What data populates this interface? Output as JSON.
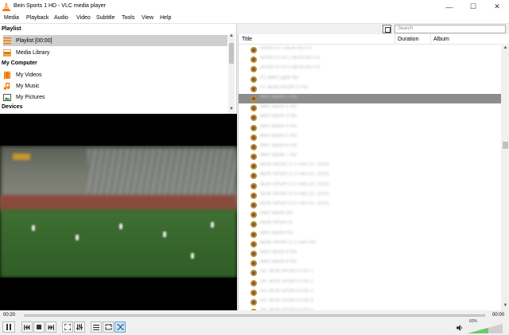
{
  "window": {
    "title": "Bein Sports 1 HD - VLC media player",
    "min_glyph": "—",
    "max_glyph": "☐",
    "close_glyph": "✕"
  },
  "menu": [
    "Media",
    "Playback",
    "Audio",
    "Video",
    "Subtitle",
    "Tools",
    "View",
    "Help"
  ],
  "sidebar": {
    "playlist_header": "Playlist",
    "playlist_item": "Playlist [00:00]",
    "media_library": "Media Library",
    "mycomputer_header": "My Computer",
    "my_videos": "My Videos",
    "my_music": "My Music",
    "my_pictures": "My Pictures",
    "devices_header": "Devices"
  },
  "search": {
    "placeholder": "Search"
  },
  "playlist": {
    "columns": {
      "title": "Title",
      "duration": "Duration",
      "album": "Album"
    },
    "current_index": 5,
    "rows": [
      "SPORTS 1 BEIN HD FR",
      "SPORTS FR 2 BEIN HD FR",
      "SPORTS FR 3 BEIN HD FR",
      "FC Bein Ligue HD",
      "FC BEIN SPORTS HD",
      "Bein Sports 1 HD",
      "Bein Sports 2 HD",
      "Bein Sports 3 HD",
      "Bein Sports 4 HD",
      "Bein Sports 5 HD",
      "Bein Sports 6 HD",
      "Bein Sports 7 HD",
      "BEIN SPORTS 1 Fans (S. 2020)",
      "BEIN SPORTS 2 Fans (S. 2020)",
      "BEIN SPORTS 3 Fans (S. 2020)",
      "BEIN SPORTS 4 Fans (S. 2020)",
      "BEIN SPORTS 5 Fans (S. 2020)",
      "Bein Sports HD",
      "BEIN SPORTS",
      "Bein Sports HD",
      "BEIN SPORTS 1 Fans HD",
      "Bein Sports 8 HD",
      "Bein Sports 9 HD",
      "SA. BEIN SPORTS HD 1",
      "SA. BEIN SPORTS HD 2",
      "SA. BEIN SPORTS HD 3",
      "SA. BEIN SPORTS HD 4",
      "SA. BEIN SPORTS HD 5",
      "BEIN SPORTS HD",
      "SA. BEIN SPORTS HD 6"
    ]
  },
  "player": {
    "elapsed": "00:20",
    "remaining": "00:00",
    "progress_fraction": 0.0,
    "volume_label": "60%",
    "volume_fraction": 0.6
  },
  "colors": {
    "cone_orange": "#f47b00",
    "selection_gray": "#8d8d8d",
    "volume_green": "#6bc96b"
  }
}
